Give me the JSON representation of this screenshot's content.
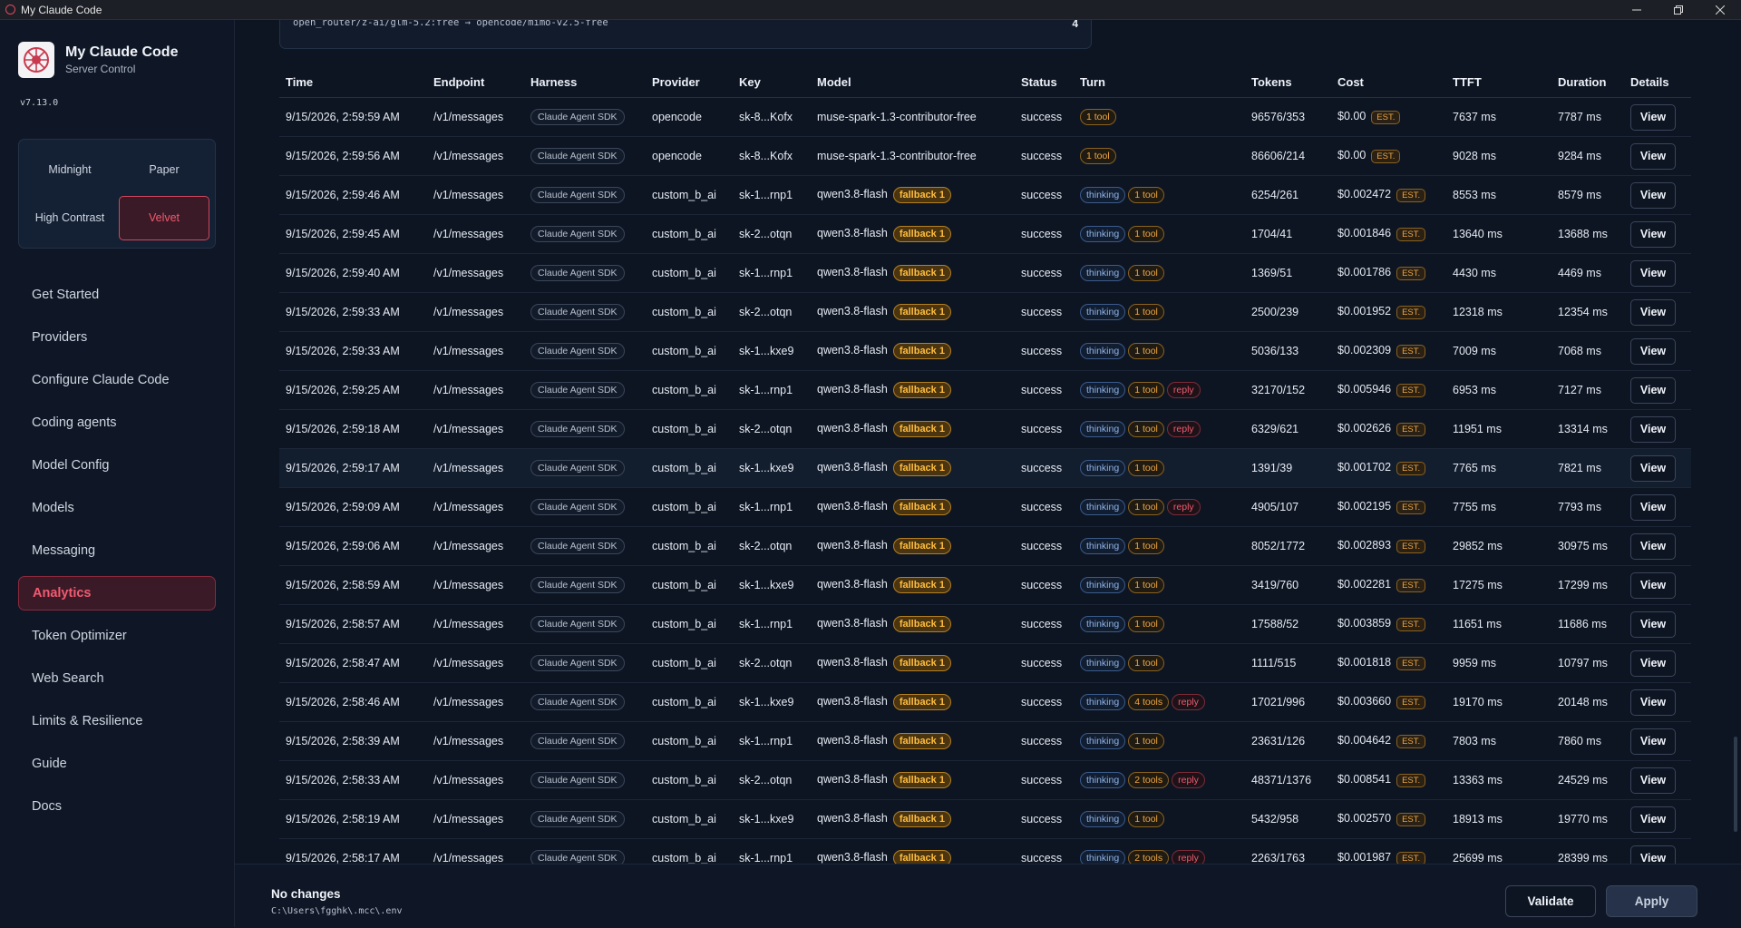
{
  "window": {
    "title": "My Claude Code"
  },
  "brand": {
    "name": "My Claude Code",
    "subtitle": "Server Control",
    "version": "v7.13.0"
  },
  "themes": [
    {
      "label": "Midnight",
      "active": false
    },
    {
      "label": "Paper",
      "active": false
    },
    {
      "label": "High Contrast",
      "active": false
    },
    {
      "label": "Velvet",
      "active": true
    }
  ],
  "nav": [
    {
      "label": "Get Started",
      "active": false
    },
    {
      "label": "Providers",
      "active": false
    },
    {
      "label": "Configure Claude Code",
      "active": false
    },
    {
      "label": "Coding agents",
      "active": false
    },
    {
      "label": "Model Config",
      "active": false
    },
    {
      "label": "Models",
      "active": false
    },
    {
      "label": "Messaging",
      "active": false
    },
    {
      "label": "Analytics",
      "active": true
    },
    {
      "label": "Token Optimizer",
      "active": false
    },
    {
      "label": "Web Search",
      "active": false
    },
    {
      "label": "Limits & Resilience",
      "active": false
    },
    {
      "label": "Guide",
      "active": false
    },
    {
      "label": "Docs",
      "active": false
    }
  ],
  "route_card": {
    "text": "open_router/z-ai/glm-5.2:free → opencode/mimo-v2.5-free",
    "count": "4"
  },
  "table": {
    "columns": [
      "Time",
      "Endpoint",
      "Harness",
      "Provider",
      "Key",
      "Model",
      "Status",
      "Turn",
      "Tokens",
      "Cost",
      "TTFT",
      "Duration",
      "Details"
    ],
    "view_label": "View",
    "est_label": "EST.",
    "rows": [
      {
        "time": "9/15/2026, 2:59:59 AM",
        "endpoint": "/v1/messages",
        "harness": "Claude Agent SDK",
        "provider": "opencode",
        "key": "sk-8...Kofx",
        "model": "muse-spark-1.3-contributor-free",
        "fallback": "",
        "status": "success",
        "turn": [
          "1 tool"
        ],
        "tokens": "96576/353",
        "cost": "$0.00",
        "ttft": "7637 ms",
        "duration": "7787 ms"
      },
      {
        "time": "9/15/2026, 2:59:56 AM",
        "endpoint": "/v1/messages",
        "harness": "Claude Agent SDK",
        "provider": "opencode",
        "key": "sk-8...Kofx",
        "model": "muse-spark-1.3-contributor-free",
        "fallback": "",
        "status": "success",
        "turn": [
          "1 tool"
        ],
        "tokens": "86606/214",
        "cost": "$0.00",
        "ttft": "9028 ms",
        "duration": "9284 ms"
      },
      {
        "time": "9/15/2026, 2:59:46 AM",
        "endpoint": "/v1/messages",
        "harness": "Claude Agent SDK",
        "provider": "custom_b_ai",
        "key": "sk-1...rnp1",
        "model": "qwen3.8-flash",
        "fallback": "fallback 1",
        "status": "success",
        "turn": [
          "thinking",
          "1 tool"
        ],
        "tokens": "6254/261",
        "cost": "$0.002472",
        "ttft": "8553 ms",
        "duration": "8579 ms"
      },
      {
        "time": "9/15/2026, 2:59:45 AM",
        "endpoint": "/v1/messages",
        "harness": "Claude Agent SDK",
        "provider": "custom_b_ai",
        "key": "sk-2...otqn",
        "model": "qwen3.8-flash",
        "fallback": "fallback 1",
        "status": "success",
        "turn": [
          "thinking",
          "1 tool"
        ],
        "tokens": "1704/41",
        "cost": "$0.001846",
        "ttft": "13640 ms",
        "duration": "13688 ms"
      },
      {
        "time": "9/15/2026, 2:59:40 AM",
        "endpoint": "/v1/messages",
        "harness": "Claude Agent SDK",
        "provider": "custom_b_ai",
        "key": "sk-1...rnp1",
        "model": "qwen3.8-flash",
        "fallback": "fallback 1",
        "status": "success",
        "turn": [
          "thinking",
          "1 tool"
        ],
        "tokens": "1369/51",
        "cost": "$0.001786",
        "ttft": "4430 ms",
        "duration": "4469 ms"
      },
      {
        "time": "9/15/2026, 2:59:33 AM",
        "endpoint": "/v1/messages",
        "harness": "Claude Agent SDK",
        "provider": "custom_b_ai",
        "key": "sk-2...otqn",
        "model": "qwen3.8-flash",
        "fallback": "fallback 1",
        "status": "success",
        "turn": [
          "thinking",
          "1 tool"
        ],
        "tokens": "2500/239",
        "cost": "$0.001952",
        "ttft": "12318 ms",
        "duration": "12354 ms"
      },
      {
        "time": "9/15/2026, 2:59:33 AM",
        "endpoint": "/v1/messages",
        "harness": "Claude Agent SDK",
        "provider": "custom_b_ai",
        "key": "sk-1...kxe9",
        "model": "qwen3.8-flash",
        "fallback": "fallback 1",
        "status": "success",
        "turn": [
          "thinking",
          "1 tool"
        ],
        "tokens": "5036/133",
        "cost": "$0.002309",
        "ttft": "7009 ms",
        "duration": "7068 ms"
      },
      {
        "time": "9/15/2026, 2:59:25 AM",
        "endpoint": "/v1/messages",
        "harness": "Claude Agent SDK",
        "provider": "custom_b_ai",
        "key": "sk-1...rnp1",
        "model": "qwen3.8-flash",
        "fallback": "fallback 1",
        "status": "success",
        "turn": [
          "thinking",
          "1 tool",
          "reply"
        ],
        "tokens": "32170/152",
        "cost": "$0.005946",
        "ttft": "6953 ms",
        "duration": "7127 ms"
      },
      {
        "time": "9/15/2026, 2:59:18 AM",
        "endpoint": "/v1/messages",
        "harness": "Claude Agent SDK",
        "provider": "custom_b_ai",
        "key": "sk-2...otqn",
        "model": "qwen3.8-flash",
        "fallback": "fallback 1",
        "status": "success",
        "turn": [
          "thinking",
          "1 tool",
          "reply"
        ],
        "tokens": "6329/621",
        "cost": "$0.002626",
        "ttft": "11951 ms",
        "duration": "13314 ms"
      },
      {
        "time": "9/15/2026, 2:59:17 AM",
        "endpoint": "/v1/messages",
        "harness": "Claude Agent SDK",
        "provider": "custom_b_ai",
        "key": "sk-1...kxe9",
        "model": "qwen3.8-flash",
        "fallback": "fallback 1",
        "status": "success",
        "turn": [
          "thinking",
          "1 tool"
        ],
        "tokens": "1391/39",
        "cost": "$0.001702",
        "ttft": "7765 ms",
        "duration": "7821 ms",
        "highlight": true
      },
      {
        "time": "9/15/2026, 2:59:09 AM",
        "endpoint": "/v1/messages",
        "harness": "Claude Agent SDK",
        "provider": "custom_b_ai",
        "key": "sk-1...rnp1",
        "model": "qwen3.8-flash",
        "fallback": "fallback 1",
        "status": "success",
        "turn": [
          "thinking",
          "1 tool",
          "reply"
        ],
        "tokens": "4905/107",
        "cost": "$0.002195",
        "ttft": "7755 ms",
        "duration": "7793 ms"
      },
      {
        "time": "9/15/2026, 2:59:06 AM",
        "endpoint": "/v1/messages",
        "harness": "Claude Agent SDK",
        "provider": "custom_b_ai",
        "key": "sk-2...otqn",
        "model": "qwen3.8-flash",
        "fallback": "fallback 1",
        "status": "success",
        "turn": [
          "thinking",
          "1 tool"
        ],
        "tokens": "8052/1772",
        "cost": "$0.002893",
        "ttft": "29852 ms",
        "duration": "30975 ms"
      },
      {
        "time": "9/15/2026, 2:58:59 AM",
        "endpoint": "/v1/messages",
        "harness": "Claude Agent SDK",
        "provider": "custom_b_ai",
        "key": "sk-1...kxe9",
        "model": "qwen3.8-flash",
        "fallback": "fallback 1",
        "status": "success",
        "turn": [
          "thinking",
          "1 tool"
        ],
        "tokens": "3419/760",
        "cost": "$0.002281",
        "ttft": "17275 ms",
        "duration": "17299 ms"
      },
      {
        "time": "9/15/2026, 2:58:57 AM",
        "endpoint": "/v1/messages",
        "harness": "Claude Agent SDK",
        "provider": "custom_b_ai",
        "key": "sk-1...rnp1",
        "model": "qwen3.8-flash",
        "fallback": "fallback 1",
        "status": "success",
        "turn": [
          "thinking",
          "1 tool"
        ],
        "tokens": "17588/52",
        "cost": "$0.003859",
        "ttft": "11651 ms",
        "duration": "11686 ms"
      },
      {
        "time": "9/15/2026, 2:58:47 AM",
        "endpoint": "/v1/messages",
        "harness": "Claude Agent SDK",
        "provider": "custom_b_ai",
        "key": "sk-2...otqn",
        "model": "qwen3.8-flash",
        "fallback": "fallback 1",
        "status": "success",
        "turn": [
          "thinking",
          "1 tool"
        ],
        "tokens": "1111/515",
        "cost": "$0.001818",
        "ttft": "9959 ms",
        "duration": "10797 ms"
      },
      {
        "time": "9/15/2026, 2:58:46 AM",
        "endpoint": "/v1/messages",
        "harness": "Claude Agent SDK",
        "provider": "custom_b_ai",
        "key": "sk-1...kxe9",
        "model": "qwen3.8-flash",
        "fallback": "fallback 1",
        "status": "success",
        "turn": [
          "thinking",
          "4 tools",
          "reply"
        ],
        "tokens": "17021/996",
        "cost": "$0.003660",
        "ttft": "19170 ms",
        "duration": "20148 ms"
      },
      {
        "time": "9/15/2026, 2:58:39 AM",
        "endpoint": "/v1/messages",
        "harness": "Claude Agent SDK",
        "provider": "custom_b_ai",
        "key": "sk-1...rnp1",
        "model": "qwen3.8-flash",
        "fallback": "fallback 1",
        "status": "success",
        "turn": [
          "thinking",
          "1 tool"
        ],
        "tokens": "23631/126",
        "cost": "$0.004642",
        "ttft": "7803 ms",
        "duration": "7860 ms"
      },
      {
        "time": "9/15/2026, 2:58:33 AM",
        "endpoint": "/v1/messages",
        "harness": "Claude Agent SDK",
        "provider": "custom_b_ai",
        "key": "sk-2...otqn",
        "model": "qwen3.8-flash",
        "fallback": "fallback 1",
        "status": "success",
        "turn": [
          "thinking",
          "2 tools",
          "reply"
        ],
        "tokens": "48371/1376",
        "cost": "$0.008541",
        "ttft": "13363 ms",
        "duration": "24529 ms"
      },
      {
        "time": "9/15/2026, 2:58:19 AM",
        "endpoint": "/v1/messages",
        "harness": "Claude Agent SDK",
        "provider": "custom_b_ai",
        "key": "sk-1...kxe9",
        "model": "qwen3.8-flash",
        "fallback": "fallback 1",
        "status": "success",
        "turn": [
          "thinking",
          "1 tool"
        ],
        "tokens": "5432/958",
        "cost": "$0.002570",
        "ttft": "18913 ms",
        "duration": "19770 ms"
      },
      {
        "time": "9/15/2026, 2:58:17 AM",
        "endpoint": "/v1/messages",
        "harness": "Claude Agent SDK",
        "provider": "custom_b_ai",
        "key": "sk-1...rnp1",
        "model": "qwen3.8-flash",
        "fallback": "fallback 1",
        "status": "success",
        "turn": [
          "thinking",
          "2 tools",
          "reply"
        ],
        "tokens": "2263/1763",
        "cost": "$0.001987",
        "ttft": "25699 ms",
        "duration": "28399 ms"
      }
    ]
  },
  "footer": {
    "title": "No changes",
    "path": "C:\\Users\\fgghk\\.mcc\\.env",
    "validate_label": "Validate",
    "apply_label": "Apply"
  },
  "colors": {
    "accent": "#f05a6e",
    "background": "#0d1523",
    "sidebar": "#0f1726",
    "warning": "#ffbe3f",
    "info": "#8fb4ea"
  }
}
